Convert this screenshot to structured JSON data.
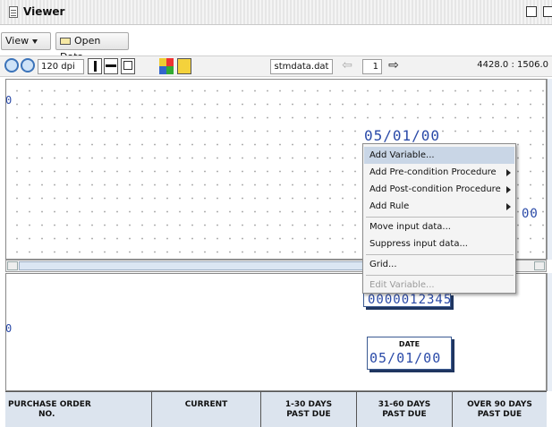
{
  "window": {
    "title": "Viewer"
  },
  "menubar": {
    "view_label": "View",
    "open_data_label": "Open Data"
  },
  "toolbar": {
    "dpi": "120 dpi",
    "data_file": "stmdata.dat",
    "page_number": "1",
    "coordinates": "4428.0 : 1506.0"
  },
  "upper_pane": {
    "left_edge_text": "0",
    "date_value": "05/01/00",
    "partial_right_value": "00"
  },
  "context_menu": {
    "items": [
      {
        "label": "Add Variable...",
        "selected": true,
        "submenu": false,
        "disabled": false
      },
      {
        "label": "Add Pre-condition Procedure",
        "selected": false,
        "submenu": true,
        "disabled": false
      },
      {
        "label": "Add Post-condition Procedure",
        "selected": false,
        "submenu": true,
        "disabled": false
      },
      {
        "label": "Add Rule",
        "selected": false,
        "submenu": true,
        "disabled": false
      },
      {
        "label": "Move input data...",
        "selected": false,
        "submenu": false,
        "disabled": false
      },
      {
        "label": "Suppress input data...",
        "selected": false,
        "submenu": false,
        "disabled": false
      },
      {
        "label": "Grid...",
        "selected": false,
        "submenu": false,
        "disabled": false
      },
      {
        "label": "Edit Variable...",
        "selected": false,
        "submenu": false,
        "disabled": true
      }
    ]
  },
  "lower_pane": {
    "left_edge_text": "0",
    "account_value": "0000012345",
    "date_label": "DATE",
    "date_value": "05/01/00"
  },
  "footer_columns": [
    {
      "line1": "PURCHASE ORDER",
      "line2": "NO."
    },
    {
      "line1": "CURRENT",
      "line2": ""
    },
    {
      "line1": "1-30 DAYS",
      "line2": "PAST DUE"
    },
    {
      "line1": "31-60 DAYS",
      "line2": "PAST DUE"
    },
    {
      "line1": "OVER 90 DAYS",
      "line2": "PAST DUE"
    }
  ]
}
